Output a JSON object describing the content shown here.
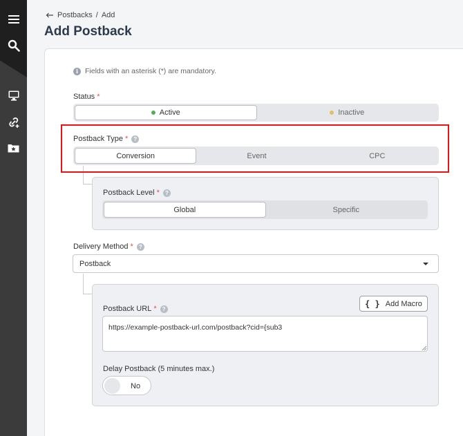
{
  "breadcrumb": {
    "parent": "Postbacks",
    "separator": "/",
    "current": "Add"
  },
  "page_title": "Add Postback",
  "notice": "Fields with an asterisk (*) are mandatory.",
  "status": {
    "label": "Status",
    "required_mark": "*",
    "options": [
      {
        "label": "Active",
        "dot_color": "#4caf50"
      },
      {
        "label": "Inactive",
        "dot_color": "#e0c060"
      }
    ],
    "selected": "Active"
  },
  "postback_type": {
    "label": "Postback Type",
    "required_mark": "*",
    "help": "?",
    "options": [
      "Conversion",
      "Event",
      "CPC"
    ],
    "selected": "Conversion"
  },
  "postback_level": {
    "label": "Postback Level",
    "required_mark": "*",
    "help": "?",
    "options": [
      "Global",
      "Specific"
    ],
    "selected": "Global"
  },
  "delivery_method": {
    "label": "Delivery Method",
    "required_mark": "*",
    "help": "?",
    "value": "Postback"
  },
  "postback_url": {
    "label": "Postback URL",
    "required_mark": "*",
    "help": "?",
    "add_macro_icon": "{ }",
    "add_macro_label": "Add Macro",
    "value": "https://example-postback-url.com/postback?cid={sub3"
  },
  "delay_postback": {
    "label": "Delay Postback (5 minutes max.)",
    "value": "No"
  },
  "colors": {
    "highlight": "#ee1111",
    "sidebar": "#3b3b3b",
    "title": "#2c3a4b"
  },
  "sidebar_icons": [
    "menu-icon",
    "search-icon",
    "monitor-icon",
    "link-add-icon",
    "folder-star-icon"
  ]
}
